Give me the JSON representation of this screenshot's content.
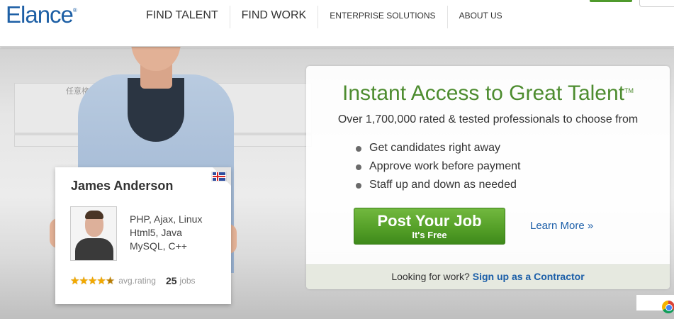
{
  "header": {
    "logo": "Elance",
    "logo_mark": "®",
    "nav": [
      {
        "label": "FIND TALENT"
      },
      {
        "label": "FIND WORK"
      },
      {
        "label": "ENTERPRISE SOLUTIONS"
      },
      {
        "label": "ABOUT US"
      }
    ]
  },
  "hero": {
    "watermark": "任意格式截图(F)",
    "profile_card": {
      "name": "James Anderson",
      "flag": "iceland-flag-icon",
      "skills": [
        "PHP, Ajax, Linux",
        "Html5, Java",
        "MySQL, C++"
      ],
      "rating_stars": 4.5,
      "rating_label": "avg.rating",
      "jobs_count": "25",
      "jobs_label": "jobs"
    },
    "promo": {
      "title": "Instant Access to Great Talent",
      "title_mark": "TM",
      "subtitle": "Over 1,700,000 rated & tested professionals to choose from",
      "bullets": [
        "Get candidates right away",
        "Approve work before payment",
        "Staff up and down as needed"
      ],
      "cta_main": "Post Your Job",
      "cta_sub": "It's Free",
      "learn_more": "Learn More »",
      "footer_question": "Looking for work?",
      "footer_link": "Sign up as a Contractor"
    }
  },
  "colors": {
    "brand_blue": "#1d5fa5",
    "title_green": "#4d8c2f",
    "button_green": "#55a028",
    "link_blue": "#1b5ea8",
    "star_gold": "#f2a900"
  }
}
